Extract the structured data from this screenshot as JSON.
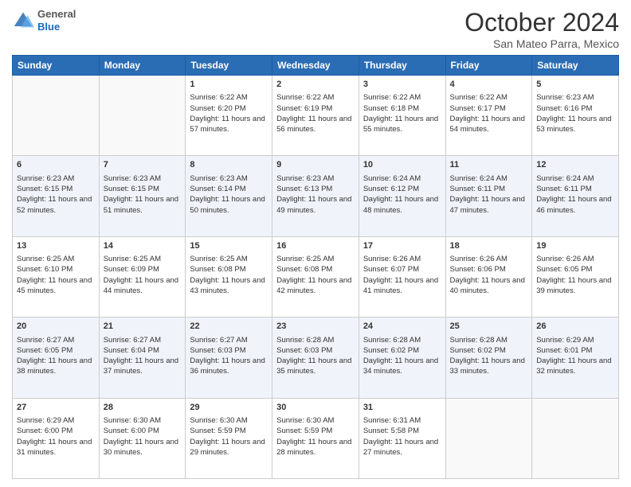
{
  "header": {
    "logo": {
      "general": "General",
      "blue": "Blue"
    },
    "title": "October 2024",
    "location": "San Mateo Parra, Mexico"
  },
  "days": [
    "Sunday",
    "Monday",
    "Tuesday",
    "Wednesday",
    "Thursday",
    "Friday",
    "Saturday"
  ],
  "weeks": [
    [
      {
        "day": null
      },
      {
        "day": null
      },
      {
        "day": 1,
        "sunrise": "Sunrise: 6:22 AM",
        "sunset": "Sunset: 6:20 PM",
        "daylight": "Daylight: 11 hours and 57 minutes."
      },
      {
        "day": 2,
        "sunrise": "Sunrise: 6:22 AM",
        "sunset": "Sunset: 6:19 PM",
        "daylight": "Daylight: 11 hours and 56 minutes."
      },
      {
        "day": 3,
        "sunrise": "Sunrise: 6:22 AM",
        "sunset": "Sunset: 6:18 PM",
        "daylight": "Daylight: 11 hours and 55 minutes."
      },
      {
        "day": 4,
        "sunrise": "Sunrise: 6:22 AM",
        "sunset": "Sunset: 6:17 PM",
        "daylight": "Daylight: 11 hours and 54 minutes."
      },
      {
        "day": 5,
        "sunrise": "Sunrise: 6:23 AM",
        "sunset": "Sunset: 6:16 PM",
        "daylight": "Daylight: 11 hours and 53 minutes."
      }
    ],
    [
      {
        "day": 6,
        "sunrise": "Sunrise: 6:23 AM",
        "sunset": "Sunset: 6:15 PM",
        "daylight": "Daylight: 11 hours and 52 minutes."
      },
      {
        "day": 7,
        "sunrise": "Sunrise: 6:23 AM",
        "sunset": "Sunset: 6:15 PM",
        "daylight": "Daylight: 11 hours and 51 minutes."
      },
      {
        "day": 8,
        "sunrise": "Sunrise: 6:23 AM",
        "sunset": "Sunset: 6:14 PM",
        "daylight": "Daylight: 11 hours and 50 minutes."
      },
      {
        "day": 9,
        "sunrise": "Sunrise: 6:23 AM",
        "sunset": "Sunset: 6:13 PM",
        "daylight": "Daylight: 11 hours and 49 minutes."
      },
      {
        "day": 10,
        "sunrise": "Sunrise: 6:24 AM",
        "sunset": "Sunset: 6:12 PM",
        "daylight": "Daylight: 11 hours and 48 minutes."
      },
      {
        "day": 11,
        "sunrise": "Sunrise: 6:24 AM",
        "sunset": "Sunset: 6:11 PM",
        "daylight": "Daylight: 11 hours and 47 minutes."
      },
      {
        "day": 12,
        "sunrise": "Sunrise: 6:24 AM",
        "sunset": "Sunset: 6:11 PM",
        "daylight": "Daylight: 11 hours and 46 minutes."
      }
    ],
    [
      {
        "day": 13,
        "sunrise": "Sunrise: 6:25 AM",
        "sunset": "Sunset: 6:10 PM",
        "daylight": "Daylight: 11 hours and 45 minutes."
      },
      {
        "day": 14,
        "sunrise": "Sunrise: 6:25 AM",
        "sunset": "Sunset: 6:09 PM",
        "daylight": "Daylight: 11 hours and 44 minutes."
      },
      {
        "day": 15,
        "sunrise": "Sunrise: 6:25 AM",
        "sunset": "Sunset: 6:08 PM",
        "daylight": "Daylight: 11 hours and 43 minutes."
      },
      {
        "day": 16,
        "sunrise": "Sunrise: 6:25 AM",
        "sunset": "Sunset: 6:08 PM",
        "daylight": "Daylight: 11 hours and 42 minutes."
      },
      {
        "day": 17,
        "sunrise": "Sunrise: 6:26 AM",
        "sunset": "Sunset: 6:07 PM",
        "daylight": "Daylight: 11 hours and 41 minutes."
      },
      {
        "day": 18,
        "sunrise": "Sunrise: 6:26 AM",
        "sunset": "Sunset: 6:06 PM",
        "daylight": "Daylight: 11 hours and 40 minutes."
      },
      {
        "day": 19,
        "sunrise": "Sunrise: 6:26 AM",
        "sunset": "Sunset: 6:05 PM",
        "daylight": "Daylight: 11 hours and 39 minutes."
      }
    ],
    [
      {
        "day": 20,
        "sunrise": "Sunrise: 6:27 AM",
        "sunset": "Sunset: 6:05 PM",
        "daylight": "Daylight: 11 hours and 38 minutes."
      },
      {
        "day": 21,
        "sunrise": "Sunrise: 6:27 AM",
        "sunset": "Sunset: 6:04 PM",
        "daylight": "Daylight: 11 hours and 37 minutes."
      },
      {
        "day": 22,
        "sunrise": "Sunrise: 6:27 AM",
        "sunset": "Sunset: 6:03 PM",
        "daylight": "Daylight: 11 hours and 36 minutes."
      },
      {
        "day": 23,
        "sunrise": "Sunrise: 6:28 AM",
        "sunset": "Sunset: 6:03 PM",
        "daylight": "Daylight: 11 hours and 35 minutes."
      },
      {
        "day": 24,
        "sunrise": "Sunrise: 6:28 AM",
        "sunset": "Sunset: 6:02 PM",
        "daylight": "Daylight: 11 hours and 34 minutes."
      },
      {
        "day": 25,
        "sunrise": "Sunrise: 6:28 AM",
        "sunset": "Sunset: 6:02 PM",
        "daylight": "Daylight: 11 hours and 33 minutes."
      },
      {
        "day": 26,
        "sunrise": "Sunrise: 6:29 AM",
        "sunset": "Sunset: 6:01 PM",
        "daylight": "Daylight: 11 hours and 32 minutes."
      }
    ],
    [
      {
        "day": 27,
        "sunrise": "Sunrise: 6:29 AM",
        "sunset": "Sunset: 6:00 PM",
        "daylight": "Daylight: 11 hours and 31 minutes."
      },
      {
        "day": 28,
        "sunrise": "Sunrise: 6:30 AM",
        "sunset": "Sunset: 6:00 PM",
        "daylight": "Daylight: 11 hours and 30 minutes."
      },
      {
        "day": 29,
        "sunrise": "Sunrise: 6:30 AM",
        "sunset": "Sunset: 5:59 PM",
        "daylight": "Daylight: 11 hours and 29 minutes."
      },
      {
        "day": 30,
        "sunrise": "Sunrise: 6:30 AM",
        "sunset": "Sunset: 5:59 PM",
        "daylight": "Daylight: 11 hours and 28 minutes."
      },
      {
        "day": 31,
        "sunrise": "Sunrise: 6:31 AM",
        "sunset": "Sunset: 5:58 PM",
        "daylight": "Daylight: 11 hours and 27 minutes."
      },
      {
        "day": null
      },
      {
        "day": null
      }
    ]
  ]
}
